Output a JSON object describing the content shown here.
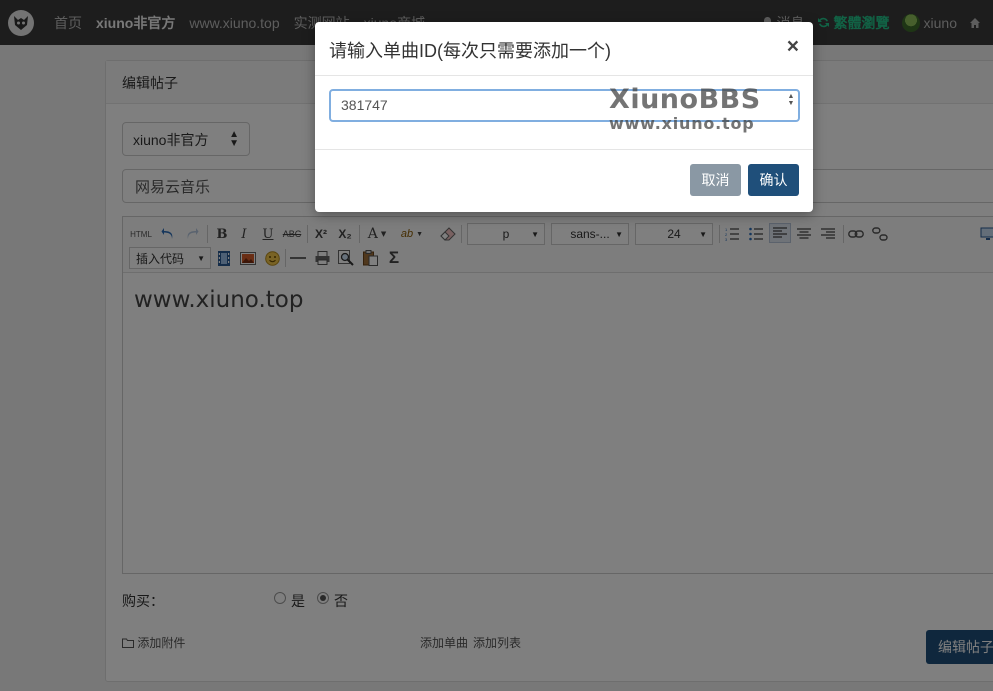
{
  "nav": {
    "links": [
      "首页",
      "xiuno非官方",
      "www.xiuno.top",
      "实测网站",
      "xiuno商城"
    ],
    "messages": "消息",
    "traditional": "繁體瀏覽",
    "username": "xiuno"
  },
  "card": {
    "header": "编辑帖子",
    "forum_select": "xiuno非官方",
    "title_value": "网易云音乐",
    "editor_content": "www.xiuno.top",
    "buy_label": "购买：",
    "buy_yes": "是",
    "buy_no": "否",
    "attach_link": "添加附件",
    "add_single": "添加单曲",
    "add_list": "添加列表",
    "submit": "编辑帖子"
  },
  "toolbar": {
    "html_label": "HTML",
    "bold": "B",
    "italic": "I",
    "underline": "U",
    "strike": "ABC",
    "superscript": "X²",
    "subscript": "X₂",
    "font_color": "A",
    "highlight": "ab",
    "paragraph": "p",
    "font_family": "sans-...",
    "font_size": "24",
    "insert_code": "插入代码",
    "sigma": "Σ"
  },
  "modal": {
    "title": "请输入单曲ID(每次只需要添加一个)",
    "close": "×",
    "input_value": "381747",
    "watermark_line1": "XiunoBBS",
    "watermark_line2": "www.xiuno.top",
    "cancel": "取消",
    "confirm": "确认"
  },
  "colors": {
    "navbar": "#3b3b3b",
    "primary": "#1f4f7a",
    "cancel": "#8a98a4",
    "nav_green": "#22c48a"
  }
}
